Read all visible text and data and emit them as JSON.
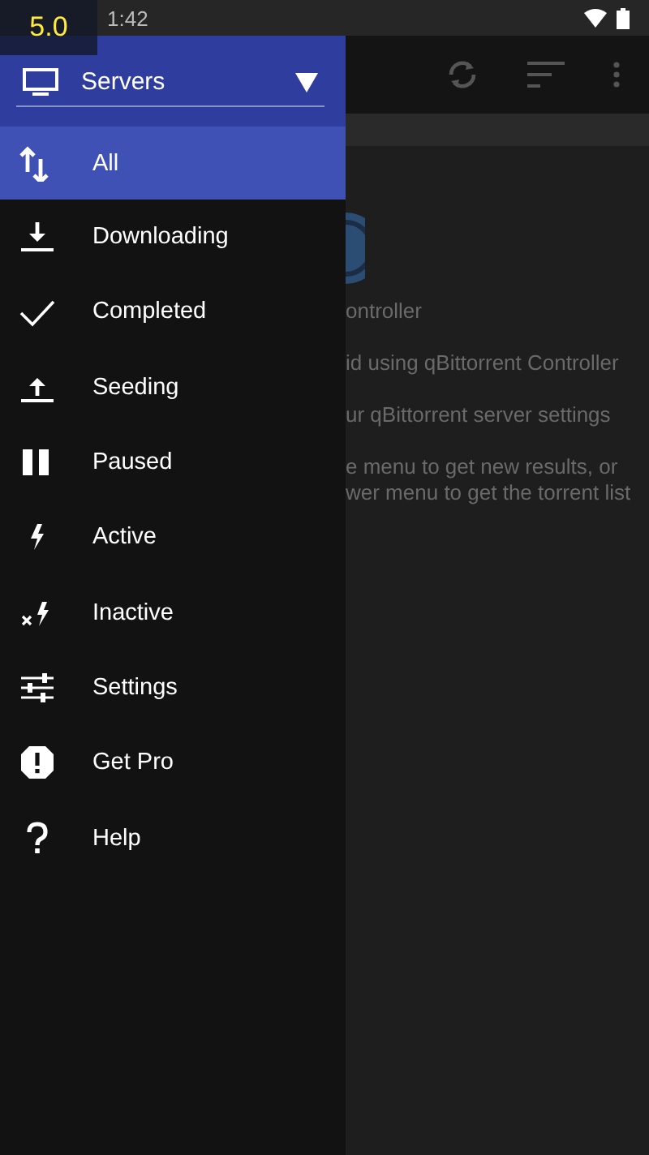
{
  "status_bar": {
    "time": "1:42",
    "badge": "5.0"
  },
  "drawer": {
    "server_dropdown": {
      "label": "Servers"
    },
    "items": [
      {
        "label": "All",
        "selected": true
      },
      {
        "label": "Downloading",
        "selected": false
      },
      {
        "label": "Completed",
        "selected": false
      },
      {
        "label": "Seeding",
        "selected": false
      },
      {
        "label": "Paused",
        "selected": false
      },
      {
        "label": "Active",
        "selected": false
      },
      {
        "label": "Inactive",
        "selected": false
      },
      {
        "label": "Settings",
        "selected": false
      },
      {
        "label": "Get Pro",
        "selected": false
      },
      {
        "label": "Help",
        "selected": false
      }
    ]
  },
  "main": {
    "lines": [
      {
        "text": "ontroller"
      },
      {
        "text": "id using qBittorrent Controller"
      },
      {
        "text": "ur qBittorrent server settings"
      },
      {
        "text": "e menu to get new results, or\nwer menu to get the torrent list"
      }
    ]
  }
}
